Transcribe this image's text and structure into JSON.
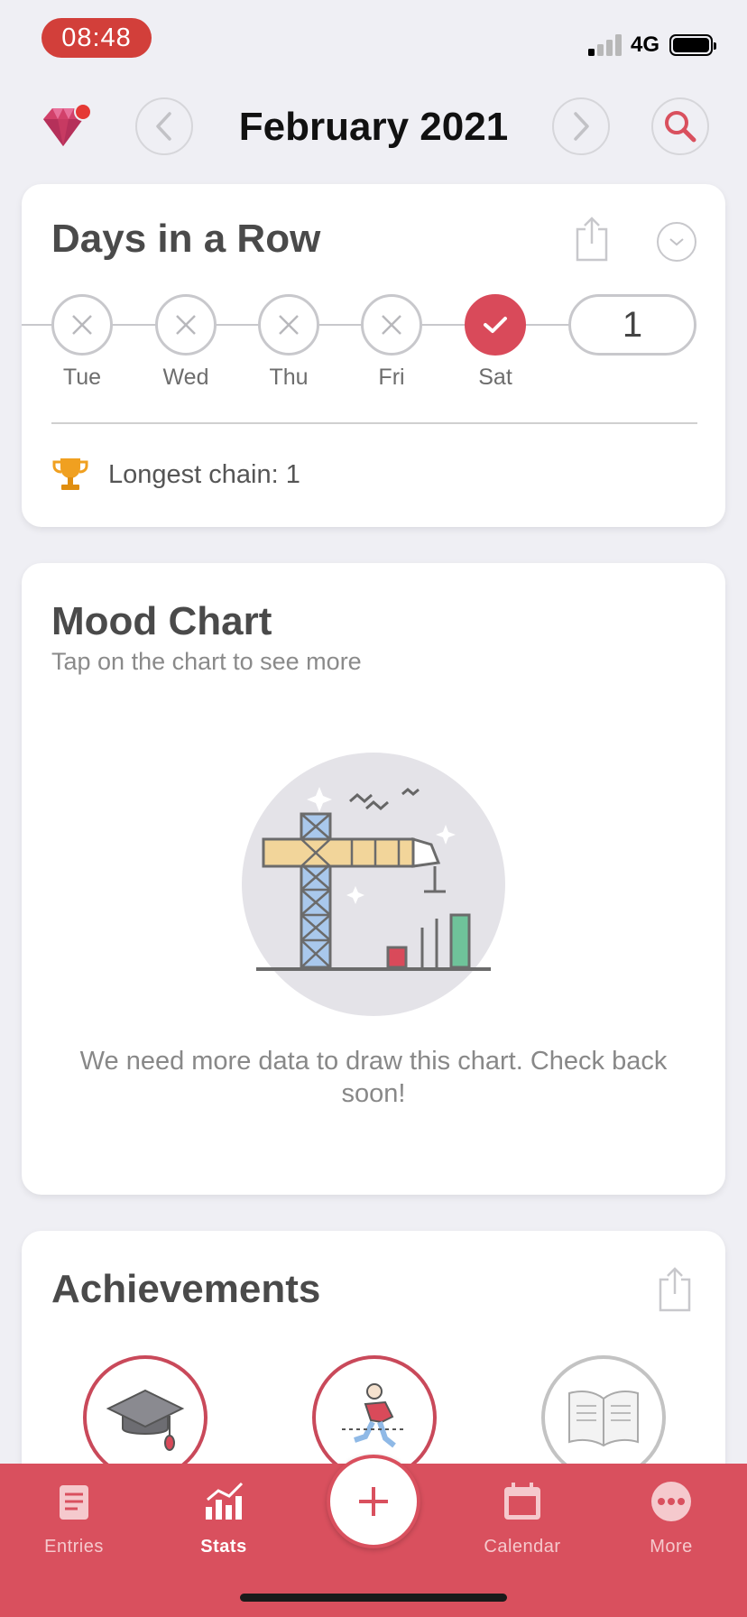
{
  "status_bar": {
    "time": "08:48",
    "network": "4G"
  },
  "header": {
    "title": "February 2021"
  },
  "days_in_a_row": {
    "title": "Days in a Row",
    "days": [
      {
        "label": "Tue",
        "done": false
      },
      {
        "label": "Wed",
        "done": false
      },
      {
        "label": "Thu",
        "done": false
      },
      {
        "label": "Fri",
        "done": false
      },
      {
        "label": "Sat",
        "done": true
      }
    ],
    "current_streak": "1",
    "longest_chain": "Longest chain: 1"
  },
  "mood_chart": {
    "title": "Mood Chart",
    "subtitle": "Tap on the chart to see more",
    "empty_message": "We need more data to draw this chart. Check back soon!"
  },
  "achievements": {
    "title": "Achievements"
  },
  "tab_bar": {
    "tabs": [
      {
        "label": "Entries",
        "icon": "entries-icon",
        "active": false
      },
      {
        "label": "Stats",
        "icon": "stats-icon",
        "active": true
      },
      {
        "label": "Calendar",
        "icon": "calendar-icon",
        "active": false
      },
      {
        "label": "More",
        "icon": "more-icon",
        "active": false
      }
    ]
  },
  "colors": {
    "accent": "#d9505e",
    "time_pill": "#d23f3a",
    "background": "#efeff4"
  }
}
